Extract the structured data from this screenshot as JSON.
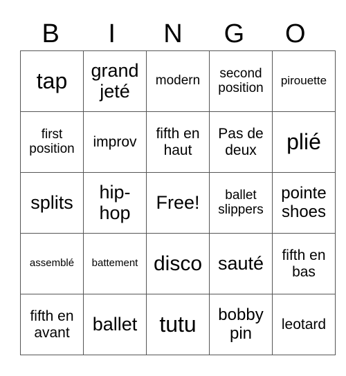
{
  "header": [
    "B",
    "I",
    "N",
    "G",
    "O"
  ],
  "grid": [
    [
      {
        "text": "tap",
        "size": "s32"
      },
      {
        "text": "grand jeté",
        "size": "s27"
      },
      {
        "text": "modern",
        "size": "s19"
      },
      {
        "text": "second position",
        "size": "s19"
      },
      {
        "text": "pirouette",
        "size": "s17"
      }
    ],
    [
      {
        "text": "first position",
        "size": "s19"
      },
      {
        "text": "improv",
        "size": "s21"
      },
      {
        "text": "fifth en haut",
        "size": "s21"
      },
      {
        "text": "Pas de deux",
        "size": "s21"
      },
      {
        "text": "plié",
        "size": "s32"
      }
    ],
    [
      {
        "text": "splits",
        "size": "s27"
      },
      {
        "text": "hip-hop",
        "size": "s27"
      },
      {
        "text": "Free!",
        "size": "s27"
      },
      {
        "text": "ballet slippers",
        "size": "s19"
      },
      {
        "text": "pointe shoes",
        "size": "s24"
      }
    ],
    [
      {
        "text": "assemblé",
        "size": "s15"
      },
      {
        "text": "battement",
        "size": "s15"
      },
      {
        "text": "disco",
        "size": "s30"
      },
      {
        "text": "sauté",
        "size": "s27"
      },
      {
        "text": "fifth en bas",
        "size": "s21"
      }
    ],
    [
      {
        "text": "fifth en avant",
        "size": "s21"
      },
      {
        "text": "ballet",
        "size": "s27"
      },
      {
        "text": "tutu",
        "size": "s32"
      },
      {
        "text": "bobby pin",
        "size": "s24"
      },
      {
        "text": "leotard",
        "size": "s21"
      }
    ]
  ]
}
